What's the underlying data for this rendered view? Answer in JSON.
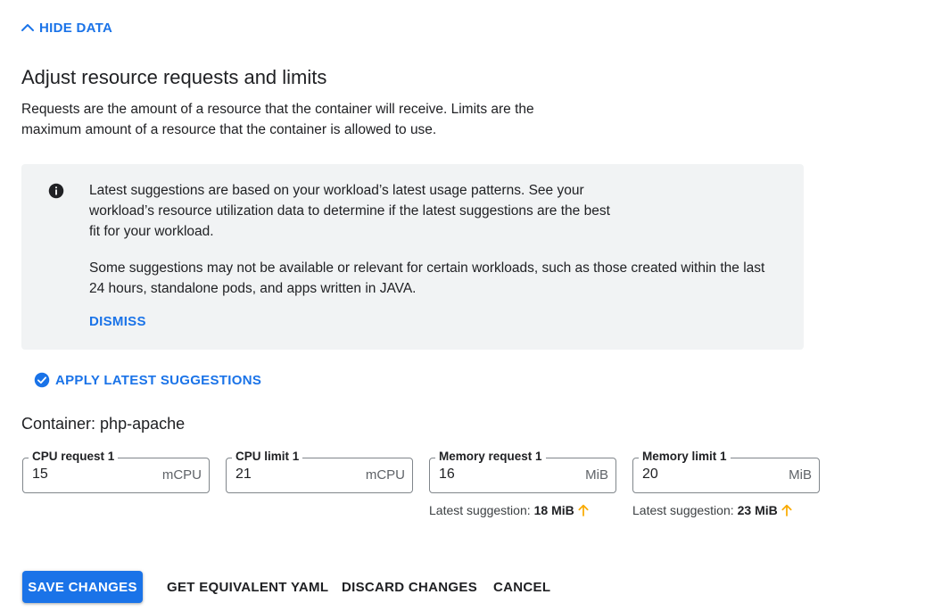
{
  "toggle": {
    "label": "HIDE DATA",
    "icon": "chevron-up-icon"
  },
  "header": {
    "title": "Adjust resource requests and limits",
    "description": "Requests are the amount of a resource that the container will receive. Limits are the maximum amount of a resource that the container is allowed to use."
  },
  "banner": {
    "icon": "info-icon",
    "paragraph1": "Latest suggestions are based on your workload’s latest usage patterns. See your workload’s resource utilization data to determine if the latest suggestions are the best fit for your workload.",
    "paragraph2": "Some suggestions may not be available or relevant for certain workloads, such as those created within the last 24 hours, standalone pods, and apps written in JAVA.",
    "dismiss_label": "DISMISS"
  },
  "apply": {
    "label": "APPLY LATEST SUGGESTIONS",
    "icon": "check-circle-icon"
  },
  "container": {
    "label": "Container: php-apache"
  },
  "fields": [
    {
      "label": "CPU request 1",
      "value": "15",
      "unit": "mCPU"
    },
    {
      "label": "CPU limit 1",
      "value": "21",
      "unit": "mCPU"
    },
    {
      "label": "Memory request 1",
      "value": "16",
      "unit": "MiB",
      "suggestion_prefix": "Latest suggestion:",
      "suggestion_value": "18 MiB",
      "suggestion_icon": "arrow-up-icon"
    },
    {
      "label": "Memory limit 1",
      "value": "20",
      "unit": "MiB",
      "suggestion_prefix": "Latest suggestion:",
      "suggestion_value": "23 MiB",
      "suggestion_icon": "arrow-up-icon"
    }
  ],
  "actions": {
    "save": "SAVE CHANGES",
    "yaml": "GET EQUIVALENT YAML",
    "discard": "DISCARD CHANGES",
    "cancel": "CANCEL"
  },
  "colors": {
    "accent": "#1a73e8",
    "banner_bg": "#f1f3f4",
    "suggestion_arrow": "#f9ab00"
  }
}
